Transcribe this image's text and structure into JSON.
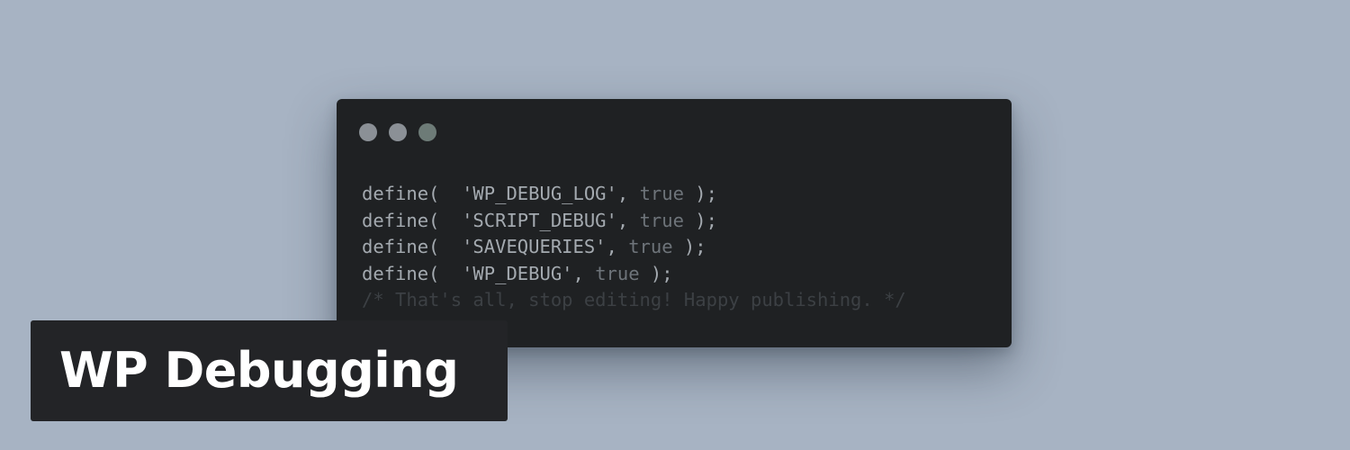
{
  "title": "WP Debugging",
  "window_controls": [
    {
      "name": "close-dot",
      "color": "#8b9096"
    },
    {
      "name": "minimize-dot",
      "color": "#8b9096"
    },
    {
      "name": "maximize-dot",
      "color": "#6d7b77"
    }
  ],
  "code": {
    "lines": [
      {
        "pre": "define(  'WP_DEBUG_LOG', ",
        "kw": "true",
        "post": " );"
      },
      {
        "pre": "define(  'SCRIPT_DEBUG', ",
        "kw": "true",
        "post": " );"
      },
      {
        "pre": "define(  'SAVEQUERIES', ",
        "kw": "true",
        "post": " );"
      },
      {
        "pre": "define(  'WP_DEBUG', ",
        "kw": "true",
        "post": " );"
      }
    ],
    "comment": "/* That's all, stop editing! Happy publishing. */"
  },
  "colors": {
    "background": "#a7b3c3",
    "code_window": "#1f2123",
    "title_box": "#232427",
    "code_text": "#a4aab0",
    "keyword": "#6e747a",
    "comment": "#3c4044"
  }
}
